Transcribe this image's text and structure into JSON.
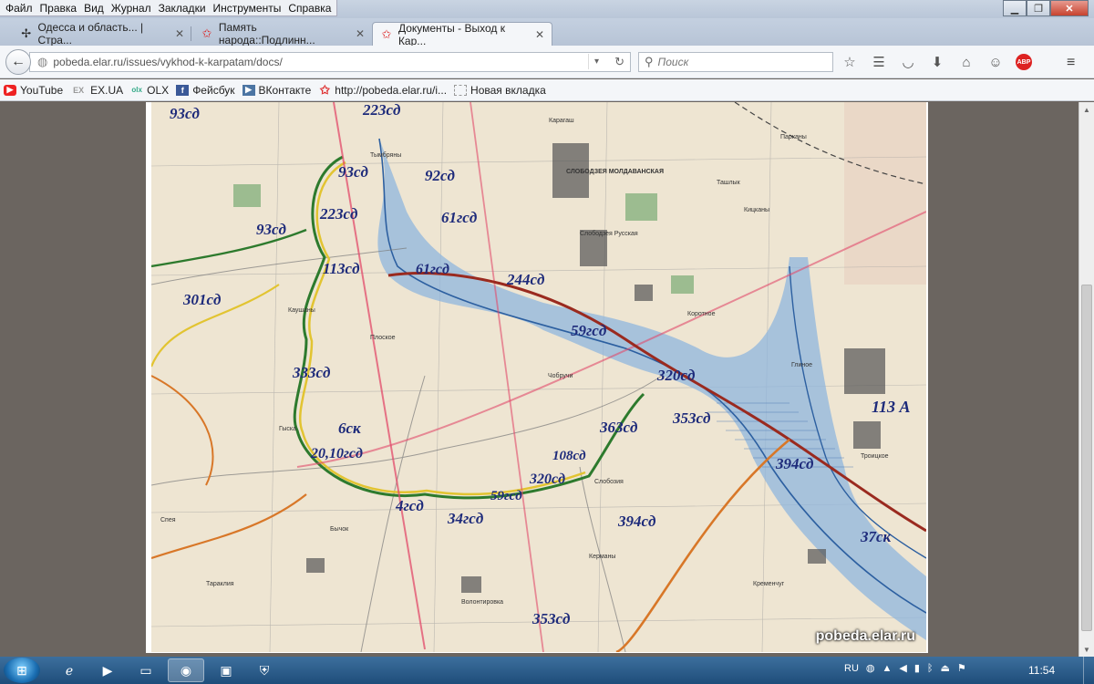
{
  "menu": [
    "Файл",
    "Правка",
    "Вид",
    "Журнал",
    "Закладки",
    "Инструменты",
    "Справка"
  ],
  "tabs": [
    {
      "label": "Одесса и область... | Стра...",
      "icon": "puzzle-icon"
    },
    {
      "label": "Память народа::Подлинн...",
      "icon": "red-star-icon"
    },
    {
      "label": "Документы - Выход к Кар...",
      "icon": "red-star-icon",
      "active": true
    }
  ],
  "nav": {
    "url": "pobeda.elar.ru/issues/vykhod-k-karpatam/docs/",
    "search_placeholder": "Поиск",
    "abp_label": "ABP"
  },
  "bookmarks": [
    {
      "label": "YouTube",
      "icon": "youtube-icon"
    },
    {
      "label": "EX.UA",
      "icon": "exua-icon"
    },
    {
      "label": "OLX",
      "icon": "olx-icon"
    },
    {
      "label": "Фейсбук",
      "icon": "facebook-icon"
    },
    {
      "label": "ВКонтакте",
      "icon": "vk-icon"
    },
    {
      "label": "http://pobeda.elar.ru/i...",
      "icon": "red-star-icon"
    },
    {
      "label": "Новая вкладка",
      "icon": "blank-page-icon"
    }
  ],
  "map": {
    "watermark": "pobeda.elar.ru",
    "unit_labels": [
      "93сд",
      "223сд",
      "93сд",
      "92сд",
      "223сд",
      "93сд",
      "301сд",
      "113сд",
      "61гсд",
      "244сд",
      "61гсд",
      "59гсд",
      "333сд",
      "320сд",
      "6ск",
      "20,10гсд",
      "363сд",
      "353сд",
      "108сд",
      "320сд",
      "4гсд",
      "59гсд",
      "34гсд",
      "394сд",
      "394сд",
      "113 А",
      "37ск",
      "353сд"
    ],
    "place_names": [
      "СЛОБОДЗЕЯ МОЛДАВАНСКАЯ",
      "Слободзея Русская",
      "Карагаш",
      "Чобручи",
      "Слобозия",
      "Волонтировка",
      "Глиное",
      "Троицкое",
      "Парканы",
      "Кицканы",
      "Каушаны",
      "Плоское",
      "Ташлык",
      "Коротное",
      "Бычок",
      "Тараклия",
      "Гыска",
      "Тымбряны",
      "Спея",
      "Кременчуг",
      "Керманы"
    ]
  },
  "taskbar": {
    "lang": "RU",
    "clock": "11:54"
  }
}
